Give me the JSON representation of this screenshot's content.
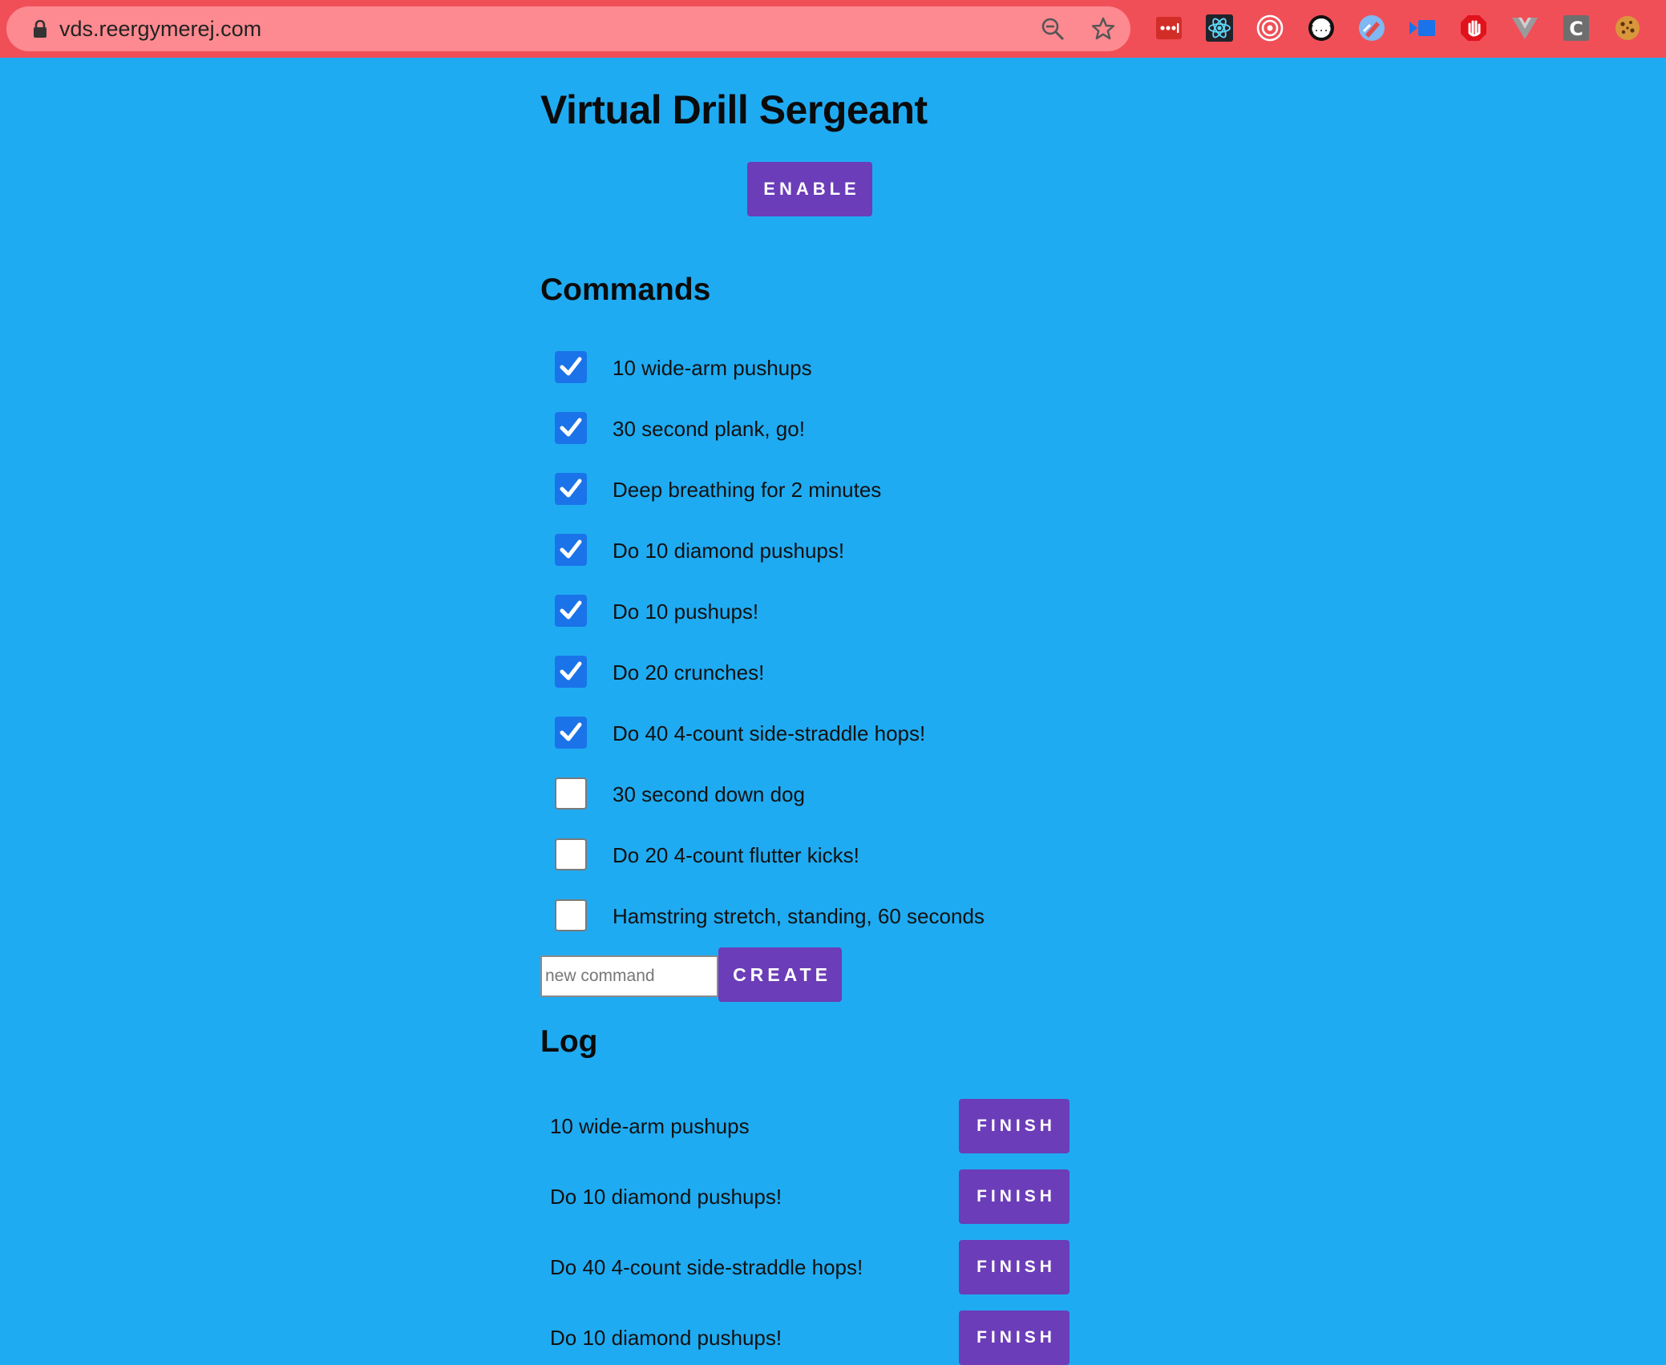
{
  "browser": {
    "url": "vds.reergymerej.com",
    "extensions": [
      "lastpass-icon",
      "react-devtools-icon",
      "target-icon",
      "json-viewer-icon",
      "color-picker-icon",
      "screen-recorder-icon",
      "adblock-icon",
      "vue-devtools-icon",
      "c-extension-icon",
      "cookie-icon"
    ]
  },
  "page": {
    "title": "Virtual Drill Sergeant",
    "enable_label": "ENABLE"
  },
  "commands": {
    "heading": "Commands",
    "items": [
      {
        "label": "10 wide-arm pushups",
        "checked": true
      },
      {
        "label": "30 second plank, go!",
        "checked": true
      },
      {
        "label": "Deep breathing for 2 minutes",
        "checked": true
      },
      {
        "label": "Do 10 diamond pushups!",
        "checked": true
      },
      {
        "label": "Do 10 pushups!",
        "checked": true
      },
      {
        "label": "Do 20 crunches!",
        "checked": true
      },
      {
        "label": "Do 40 4-count side-straddle hops!",
        "checked": true
      },
      {
        "label": "30 second down dog",
        "checked": false
      },
      {
        "label": "Do 20 4-count flutter kicks!",
        "checked": false
      },
      {
        "label": "Hamstring stretch, standing, 60 seconds",
        "checked": false
      }
    ],
    "new_placeholder": "new command",
    "new_value": "",
    "create_label": "CREATE"
  },
  "log": {
    "heading": "Log",
    "finish_label": "FINISH",
    "items": [
      "10 wide-arm pushups",
      "Do 10 diamond pushups!",
      "Do 40 4-count side-straddle hops!",
      "Do 10 diamond pushups!"
    ]
  },
  "colors": {
    "page_background": "#1fabf2",
    "browser_bar": "#f04f58",
    "button": "#6b3db8",
    "checkbox_checked": "#1a73e8"
  }
}
